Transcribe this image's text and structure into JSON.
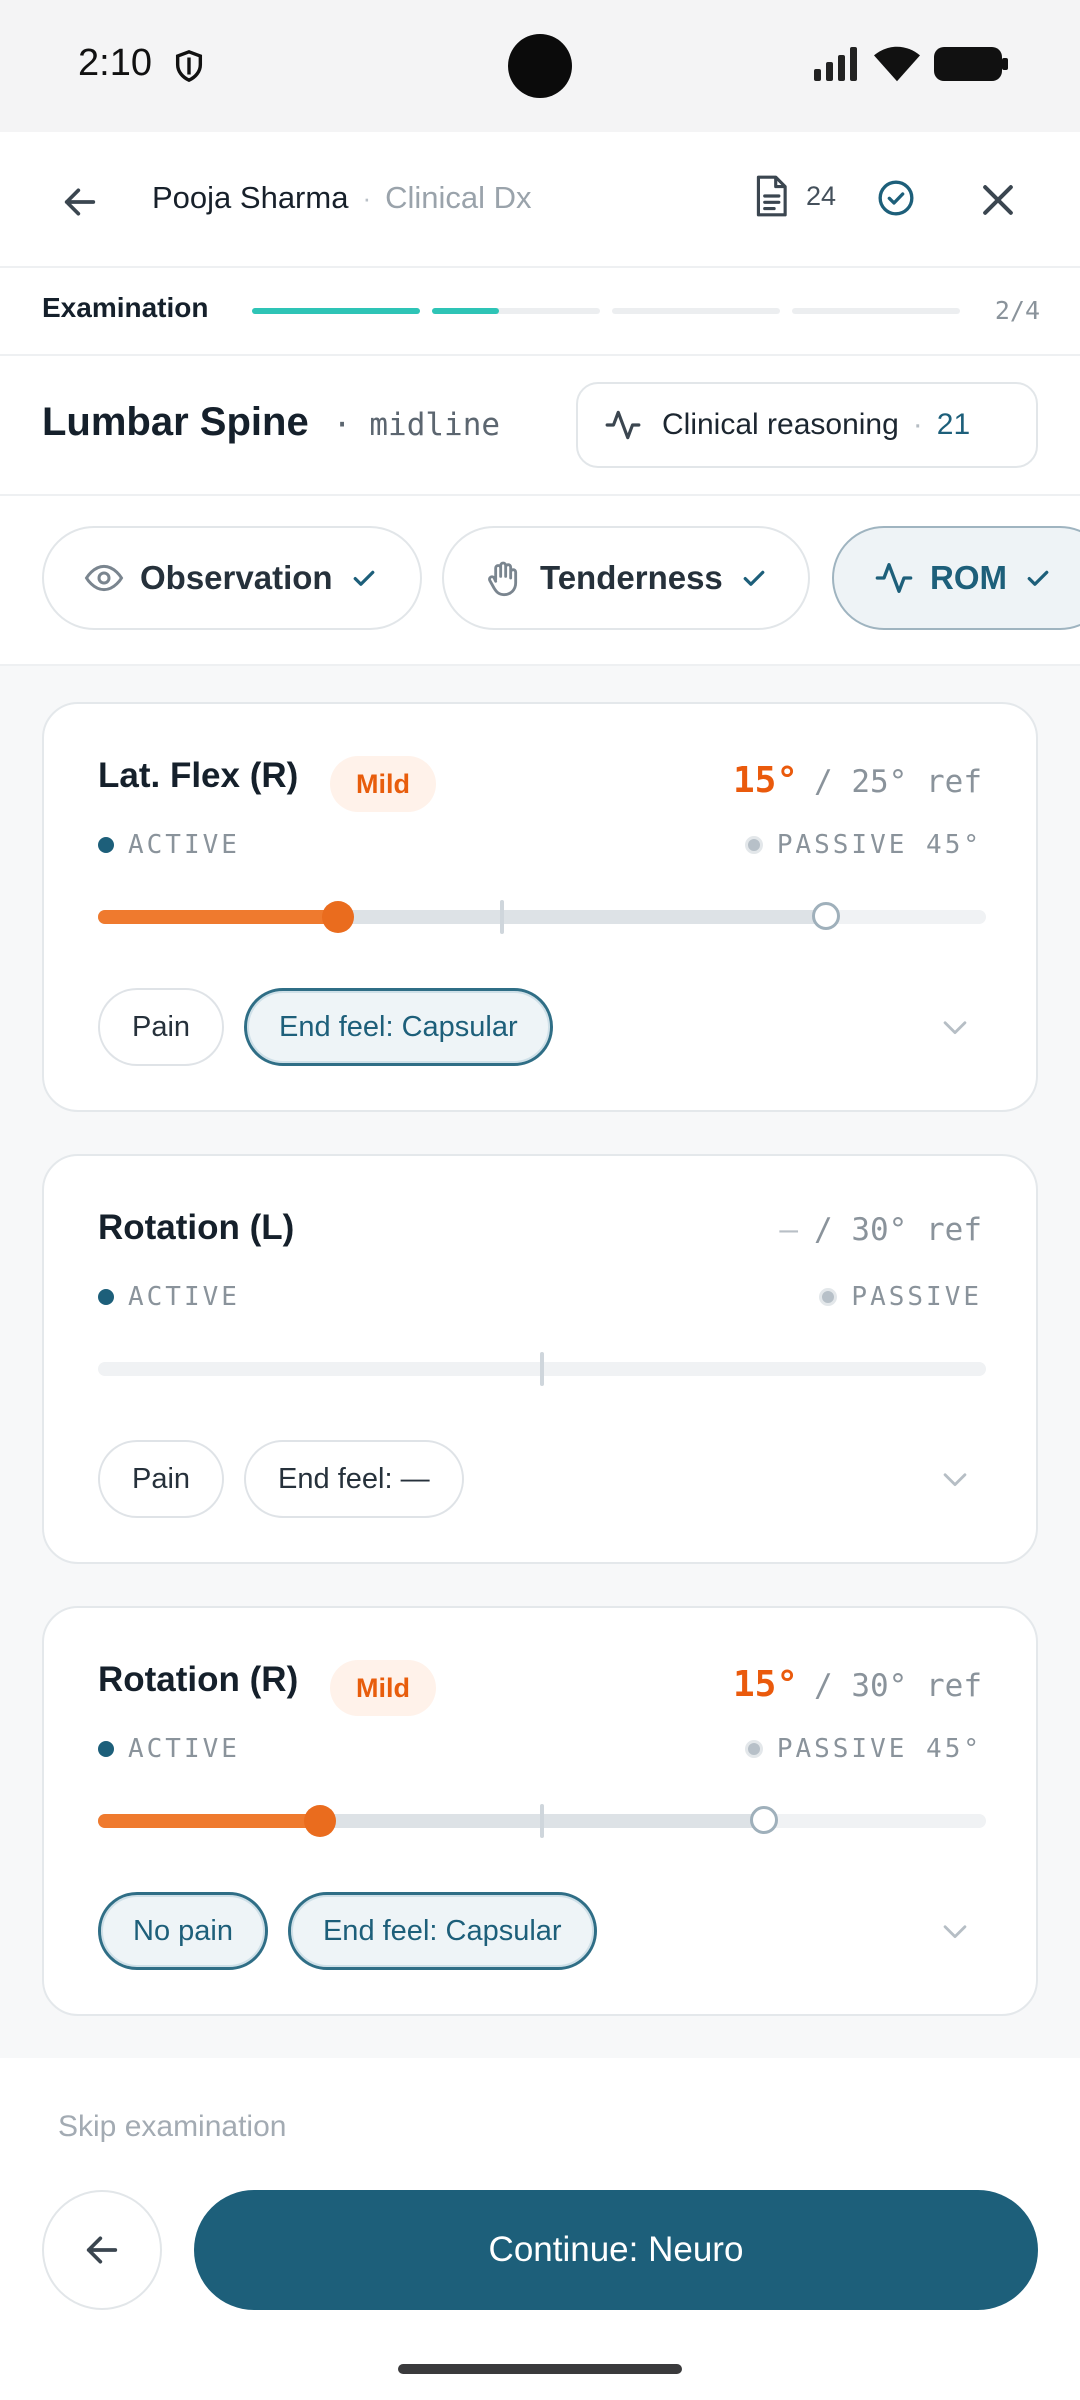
{
  "status": {
    "time": "2:10"
  },
  "header": {
    "patient_name": "Pooja Sharma",
    "separator": "·",
    "subtitle": "Clinical Dx",
    "doc_count": "24"
  },
  "progress": {
    "label": "Examination",
    "count": "2/4",
    "step_fill": [
      1.0,
      0.4,
      0,
      0
    ]
  },
  "region": {
    "title": "Lumbar Spine",
    "bullet": "·",
    "sub": "midline",
    "reasoning_label": "Clinical reasoning",
    "reasoning_sep": "·",
    "reasoning_count": "21"
  },
  "tabs": [
    {
      "label": "Observation",
      "icon": "eye-icon",
      "done": true
    },
    {
      "label": "Tenderness",
      "icon": "hand-icon",
      "done": true
    },
    {
      "label": "ROM",
      "icon": "activity-icon",
      "done": true,
      "active": true
    }
  ],
  "cards": [
    {
      "title": "Lat. Flex (R)",
      "badge": "Mild",
      "value": "15°",
      "ref": "/ 25° ref",
      "active_label": "ACTIVE",
      "passive_label": "PASSIVE 45°",
      "active_fraction": 0.27,
      "passive_fraction": 0.82,
      "ref_fraction": 0.455,
      "chips": [
        {
          "label": "Pain",
          "selected": false
        },
        {
          "label": "End feel: Capsular",
          "selected": true
        }
      ]
    },
    {
      "title": "Rotation (L)",
      "badge": "",
      "value": "—",
      "ref": "/ 30° ref",
      "active_label": "ACTIVE",
      "passive_label": "PASSIVE",
      "active_fraction": 0,
      "passive_fraction": 0,
      "ref_fraction": 0.5,
      "chips": [
        {
          "label": "Pain",
          "selected": false
        },
        {
          "label": "End feel: —",
          "selected": false
        }
      ]
    },
    {
      "title": "Rotation (R)",
      "badge": "Mild",
      "value": "15°",
      "ref": "/ 30° ref",
      "active_label": "ACTIVE",
      "passive_label": "PASSIVE 45°",
      "active_fraction": 0.25,
      "passive_fraction": 0.75,
      "ref_fraction": 0.5,
      "chips": [
        {
          "label": "No pain",
          "selected": true
        },
        {
          "label": "End feel: Capsular",
          "selected": true
        }
      ]
    }
  ],
  "footer": {
    "skip_label": "Skip examination",
    "continue_label": "Continue: Neuro"
  },
  "colors": {
    "primary": "#1d5f7a",
    "accent": "#ea5a0c",
    "progress": "#2ec4b6"
  }
}
